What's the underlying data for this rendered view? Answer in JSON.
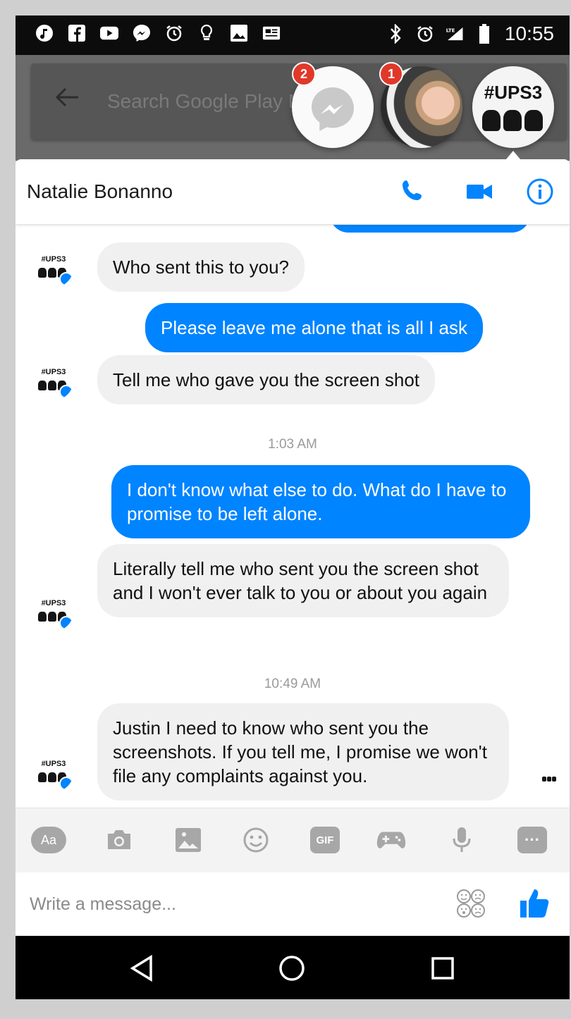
{
  "status_bar": {
    "time": "10:55",
    "left_icons": [
      "music-icon",
      "facebook-icon",
      "youtube-icon",
      "messenger-icon",
      "alarm-icon",
      "bulb-icon",
      "image-icon",
      "news-icon"
    ],
    "right_icons": [
      "bluetooth-icon",
      "alarm-icon",
      "lte-signal-icon",
      "battery-icon"
    ]
  },
  "background_app": {
    "search_placeholder": "Search Google Play Mo"
  },
  "chat_heads": {
    "messenger_badge": "2",
    "natalie_badge": "1",
    "ups3_label": "#UPS3"
  },
  "conversation": {
    "contact_name": "Natalie Bonanno",
    "avatar_label": "#UPS3",
    "messages": [
      {
        "from": "them",
        "text": "Who sent this to you?"
      },
      {
        "from": "me",
        "text": "Please leave me alone that is all I ask"
      },
      {
        "from": "them",
        "text": "Tell me who gave you the screen shot"
      },
      {
        "from": "me",
        "text": "I don't know what else to do. What do I have to promise to be left alone."
      },
      {
        "from": "them",
        "text": "Literally tell me who sent you the screen shot and I won't ever talk to you or about you again"
      },
      {
        "from": "them",
        "text": "Justin I need to know who sent you the screenshots. If you tell me, I promise we won't file any complaints against you."
      }
    ],
    "timestamps": [
      "1:03 AM",
      "10:49 AM"
    ]
  },
  "toolbar": {
    "aa_label": "Aa",
    "gif_label": "GIF",
    "more_label": "···"
  },
  "composer": {
    "placeholder": "Write a message..."
  },
  "colors": {
    "accent": "#0084ff",
    "incoming_bubble": "#f0f0f0",
    "badge": "#e0392a"
  }
}
